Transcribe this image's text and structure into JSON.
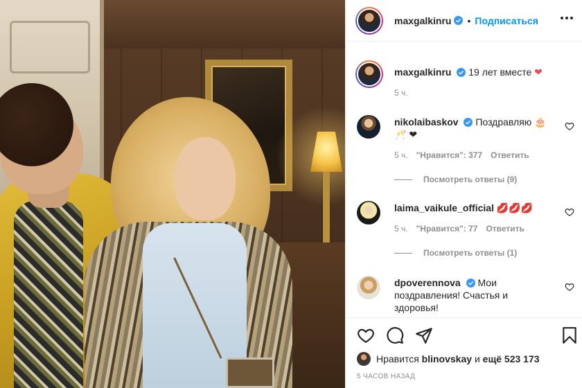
{
  "post": {
    "author": "maxgalkinru",
    "follow_label": "Подписаться",
    "dot": "•"
  },
  "caption": {
    "username": "maxgalkinru",
    "text": "19 лет вместе",
    "emoji": "❤",
    "time": "5 ч."
  },
  "comments": [
    {
      "username": "nikolaibaskov",
      "verified": true,
      "text": "Поздравляю 🎂 🥂 ❤",
      "time": "5 ч.",
      "likes": "\"Нравится\": 377",
      "reply_label": "Ответить",
      "view_replies": "Посмотреть ответы (9)"
    },
    {
      "username": "laima_vaikule_official",
      "verified": false,
      "text": "💋💋💋",
      "time": "5 ч.",
      "likes": "\"Нравится\": 77",
      "reply_label": "Ответить",
      "view_replies": "Посмотреть ответы (1)"
    },
    {
      "username": "dpoverennova",
      "verified": true,
      "text": "Мои поздравления! Счастья и здоровья!"
    }
  ],
  "likes_summary": {
    "prefix": "Нравится",
    "user": "blinovskay",
    "middle": "и",
    "count": "ещё 523 173"
  },
  "timestamp": "5 ЧАСОВ НАЗАД",
  "colors": {
    "accent": "#0095f6",
    "verified": "#3897f0",
    "heart": "#ed4956",
    "muted": "#8e8e8e"
  }
}
